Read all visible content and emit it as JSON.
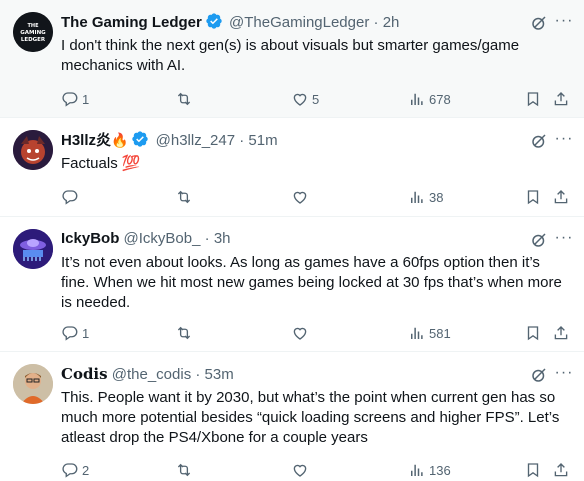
{
  "tweets": [
    {
      "name": "The Gaming Ledger",
      "handle": "@TheGamingLedger",
      "time": "2h",
      "verified": true,
      "avatar_text": "THE GAMING LEDGER",
      "text": "I don't think the next gen(s) is about visuals but smarter games/game mechanics with AI.",
      "replies": "1",
      "retweets": "",
      "likes": "5",
      "views": "678"
    },
    {
      "name": "H3llz炎",
      "name_emoji": "🔥",
      "handle": "@h3llz_247",
      "time": "51m",
      "verified": true,
      "text": "Factuals 💯",
      "replies": "",
      "retweets": "",
      "likes": "",
      "views": "38"
    },
    {
      "name": "IckyBob",
      "handle": "@IckyBob_",
      "time": "3h",
      "verified": false,
      "text": "It’s not even about looks. As long as games have a 60fps option then it’s fine. When we hit most new games being locked at 30 fps that’s when more is needed.",
      "replies": "1",
      "retweets": "",
      "likes": "",
      "views": "581"
    },
    {
      "name": "𝐂𝐨𝐝𝐢𝐬",
      "handle": "@the_codis",
      "time": "53m",
      "verified": false,
      "text": "This. People want it by 2030, but what’s the point when current gen has so much more potential besides “quick loading screens and higher FPS”. Let’s atleast drop the PS4/Xbone for a couple years",
      "replies": "2",
      "retweets": "",
      "likes": "",
      "views": "136"
    }
  ],
  "dot": "·",
  "icons": {
    "reply": "reply-icon",
    "retweet": "retweet-icon",
    "like": "heart-icon",
    "views": "views-chart-icon",
    "bookmark": "bookmark-icon",
    "share": "share-icon",
    "grok": "grok-icon",
    "more": "more-icon"
  },
  "colors": {
    "text": "#0f1419",
    "secondary": "#536471",
    "verified": "#1d9bf0",
    "highlight_bg": "#f7f9f9",
    "divider": "#eff3f4"
  }
}
